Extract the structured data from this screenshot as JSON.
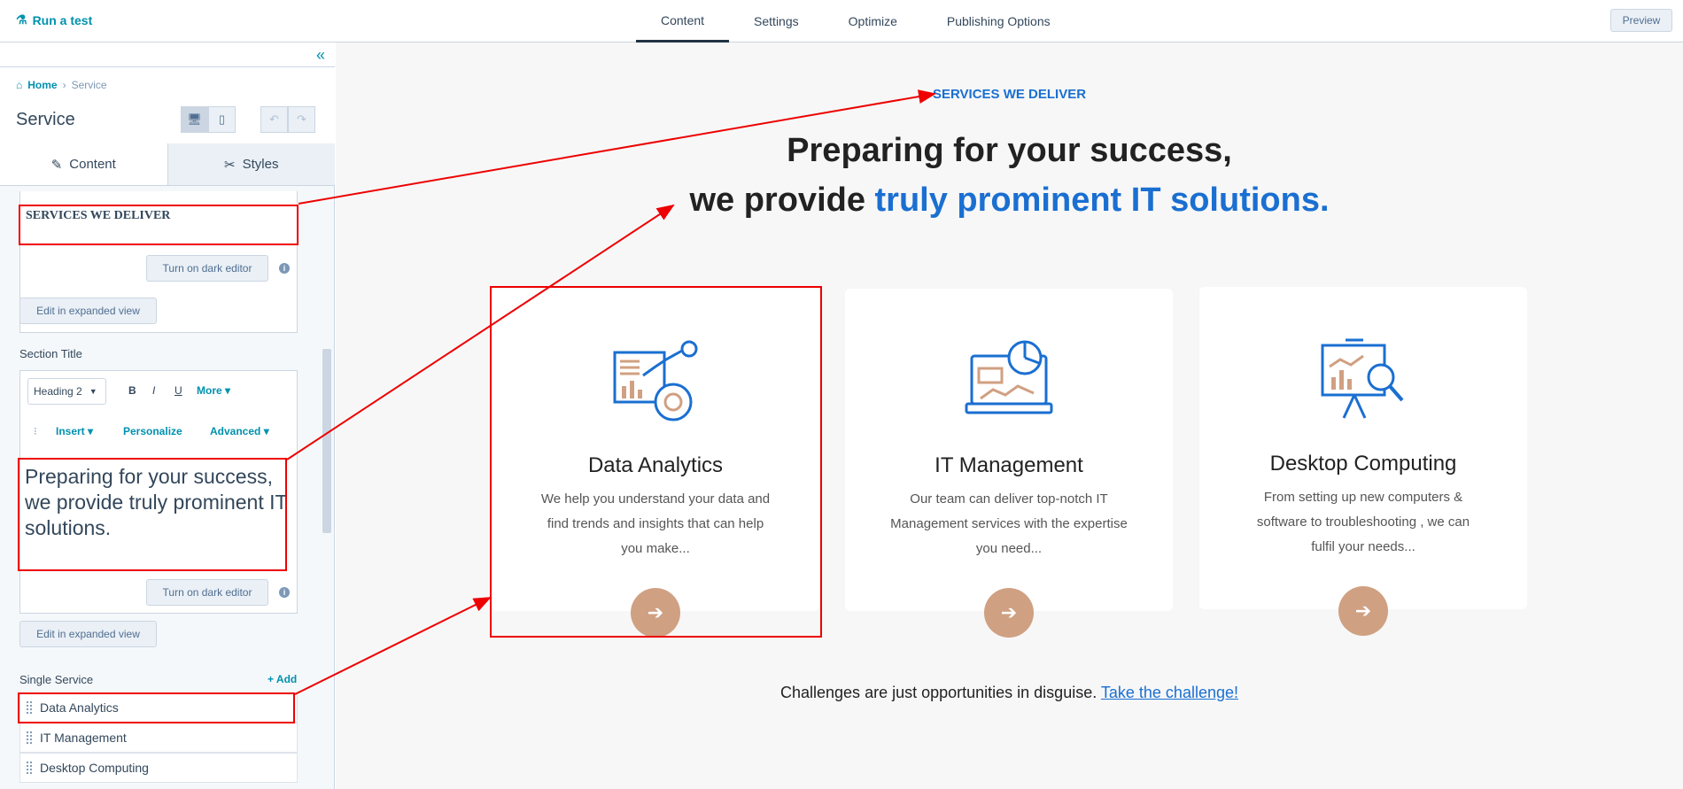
{
  "topbar": {
    "run_test": "Run a test",
    "tabs": [
      "Content",
      "Settings",
      "Optimize",
      "Publishing Options"
    ],
    "preview": "Preview"
  },
  "sidebar": {
    "breadcrumb": {
      "home": "Home",
      "current": "Service"
    },
    "module_title": "Service",
    "tabs": [
      "Content",
      "Styles"
    ],
    "eyebrow_value": "SERVICES WE DELIVER",
    "dark_editor": "Turn on dark editor",
    "expanded_view": "Edit in expanded view",
    "section_title_label": "Section Title",
    "toolbar": {
      "heading": "Heading 2",
      "bold": "B",
      "italic": "I",
      "underline": "U",
      "more": "More",
      "insert": "Insert",
      "personalize": "Personalize",
      "advanced": "Advanced"
    },
    "section_title_value": "Preparing for your success, we provide truly prominent IT solutions.",
    "single_service_label": "Single Service",
    "add": "+ Add",
    "services": [
      "Data Analytics",
      "IT Management",
      "Desktop Computing"
    ]
  },
  "canvas": {
    "eyebrow": "SERVICES WE DELIVER",
    "heading_line1": "Preparing for your success,",
    "heading_line2_plain": "we provide ",
    "heading_line2_blue": "truly prominent IT solutions.",
    "cards": [
      {
        "title": "Data Analytics",
        "desc": "We help you understand your data and find trends and insights that can help you make..."
      },
      {
        "title": "IT Management",
        "desc": "Our team can deliver top-notch IT Management services with the expertise you need..."
      },
      {
        "title": "Desktop Computing",
        "desc": "From setting up new computers & software to troubleshooting , we can fulfil your needs..."
      }
    ],
    "challenge_text": "Challenges are just opportunities in disguise. ",
    "challenge_link": "Take the challenge!"
  },
  "colors": {
    "accent": "#0091ae",
    "brand_blue": "#1a6fd1",
    "arrow_btn": "#d0a082",
    "annotation": "#e00000"
  }
}
